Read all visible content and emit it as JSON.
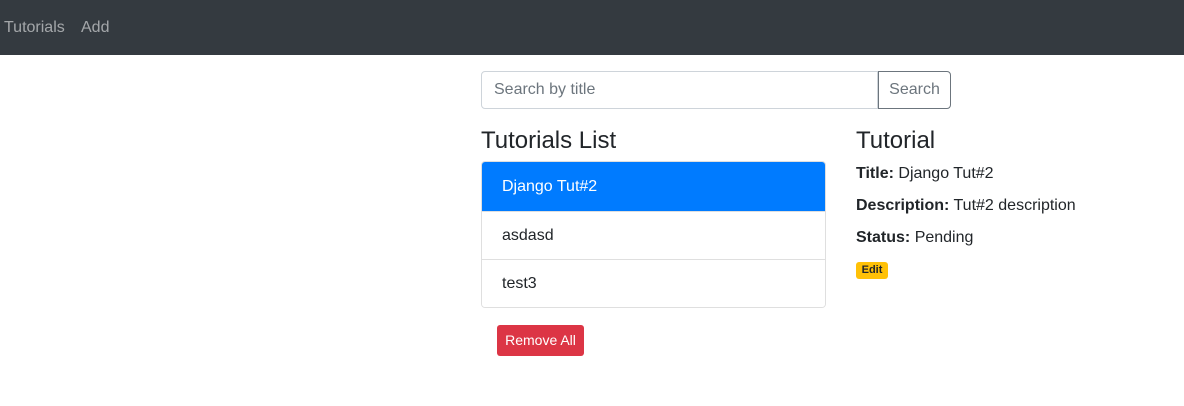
{
  "navbar": {
    "links": [
      "Tutorials",
      "Add"
    ],
    "colors": {
      "background": "#343a40",
      "link": "rgba(255,255,255,0.55)"
    }
  },
  "search": {
    "placeholder": "Search by title",
    "value": "",
    "button_label": "Search"
  },
  "tutorials_list": {
    "heading": "Tutorials List",
    "items": [
      "Django Tut#2",
      "asdasd",
      "test3"
    ],
    "active_index": 0,
    "active_color": "#007bff",
    "remove_all_label": "Remove All",
    "remove_all_color": "#dc3545"
  },
  "tutorial_detail": {
    "heading": "Tutorial",
    "title_label": "Title:",
    "title_value": "Django Tut#2",
    "description_label": "Description:",
    "description_value": "Tut#2 description",
    "status_label": "Status:",
    "status_value": "Pending",
    "edit_label": "Edit",
    "edit_color": "#ffc107"
  }
}
